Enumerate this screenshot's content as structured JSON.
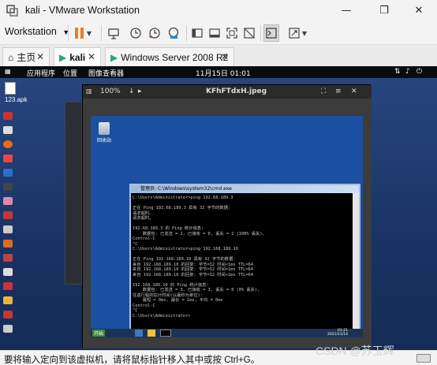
{
  "window": {
    "title": "kali - VMware Workstation",
    "minimize": "—",
    "maximize": "❐",
    "close": "✕"
  },
  "toolbar": {
    "workstation_label": "Workstation",
    "workstation_arrow": "▼"
  },
  "tabs": [
    {
      "label": "主页"
    },
    {
      "label": "kali"
    },
    {
      "label": "Windows Server 2008 R2"
    }
  ],
  "kali_panel": {
    "applications": "应用程序",
    "places": "位置",
    "image_viewer": "图像查看器",
    "clock": "11月15日 01:01"
  },
  "desktop": {
    "file_label": "123.apk"
  },
  "viewer": {
    "zoom": "100%",
    "filename": "KFhFTdxH.jpeg"
  },
  "windows_shot": {
    "recycle_bin": "回收站",
    "cmd_title": "管理员: C:\\Windows\\system32\\cmd.exe",
    "cmd_lines": [
      "C:\\Users\\Administrator>ping 192.68.189.3",
      "",
      "正在 Ping 192.68.189.3 具有 32 字节的数据:",
      "请求超时。",
      "请求超时。",
      "",
      "192.68.189.3 的 Ping 统计信息:",
      "    数据包: 已发送 = 2, 已接收 = 0, 丢失 = 2 (100% 丢失),",
      "Control-C",
      "^C",
      "C:\\Users\\Administrator>ping 192.168.189.10",
      "",
      "正在 Ping 192.168.189.10 具有 32 字节的数据:",
      "来自 192.168.189.10 的回复: 字节=32 时间<1ms TTL=64",
      "来自 192.168.189.10 的回复: 字节=32 时间<1ms TTL=64",
      "来自 192.168.189.10 的回复: 字节=32 时间<1ms TTL=64",
      "",
      "192.168.189.10 的 Ping 统计信息:",
      "    数据包: 已发送 = 3, 已接收 = 3, 丢失 = 0 (0% 丢失),",
      "往返行程的估计时间(以毫秒为单位):",
      "    最短 = 0ms, 最长 = 1ms, 平均 = 0ms",
      "Control-C",
      "^C",
      "C:\\Users\\Administrator>"
    ],
    "start": "开始",
    "tray_time": "01:21",
    "tray_date": "2021/11/14"
  },
  "statusbar": {
    "hint": "要将输入定向到该虚拟机，请将鼠标指针移入其中或按 Ctrl+G。"
  },
  "watermark": "CSDN @苏玉辉"
}
